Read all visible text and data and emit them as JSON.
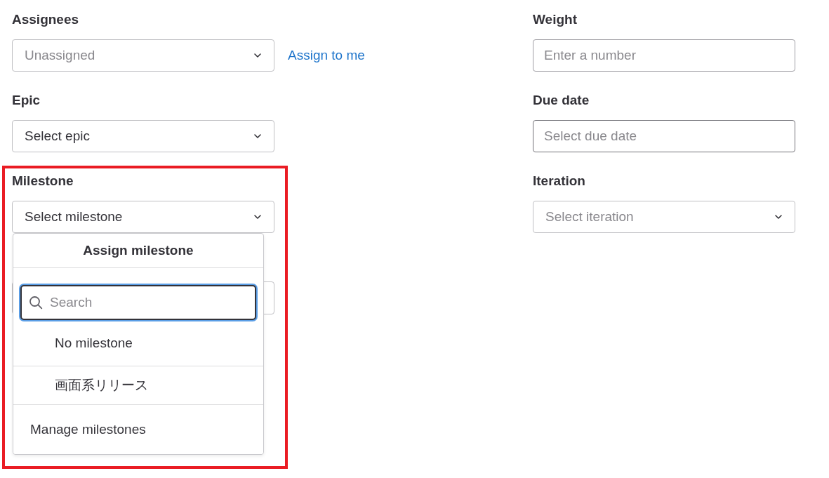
{
  "left": [
    {
      "label": "Assignees",
      "kind": "select",
      "text": "Unassigned",
      "muted": true,
      "link": "Assign to me"
    },
    {
      "label": "Epic",
      "kind": "select",
      "text": "Select epic",
      "muted": false
    },
    {
      "label": "Milestone",
      "kind": "select",
      "text": "Select milestone",
      "muted": false
    }
  ],
  "right": [
    {
      "label": "Weight",
      "kind": "input",
      "placeholder": "Enter a number"
    },
    {
      "label": "Due date",
      "kind": "date",
      "placeholder": "Select due date"
    },
    {
      "label": "Iteration",
      "kind": "select",
      "text": "Select iteration",
      "muted": true
    }
  ],
  "dropdown": {
    "title": "Assign milestone",
    "search": {
      "placeholder": "Search"
    },
    "items": [
      {
        "label": "No milestone"
      },
      {
        "label": "画面系リリース"
      }
    ],
    "footer": "Manage milestones"
  }
}
